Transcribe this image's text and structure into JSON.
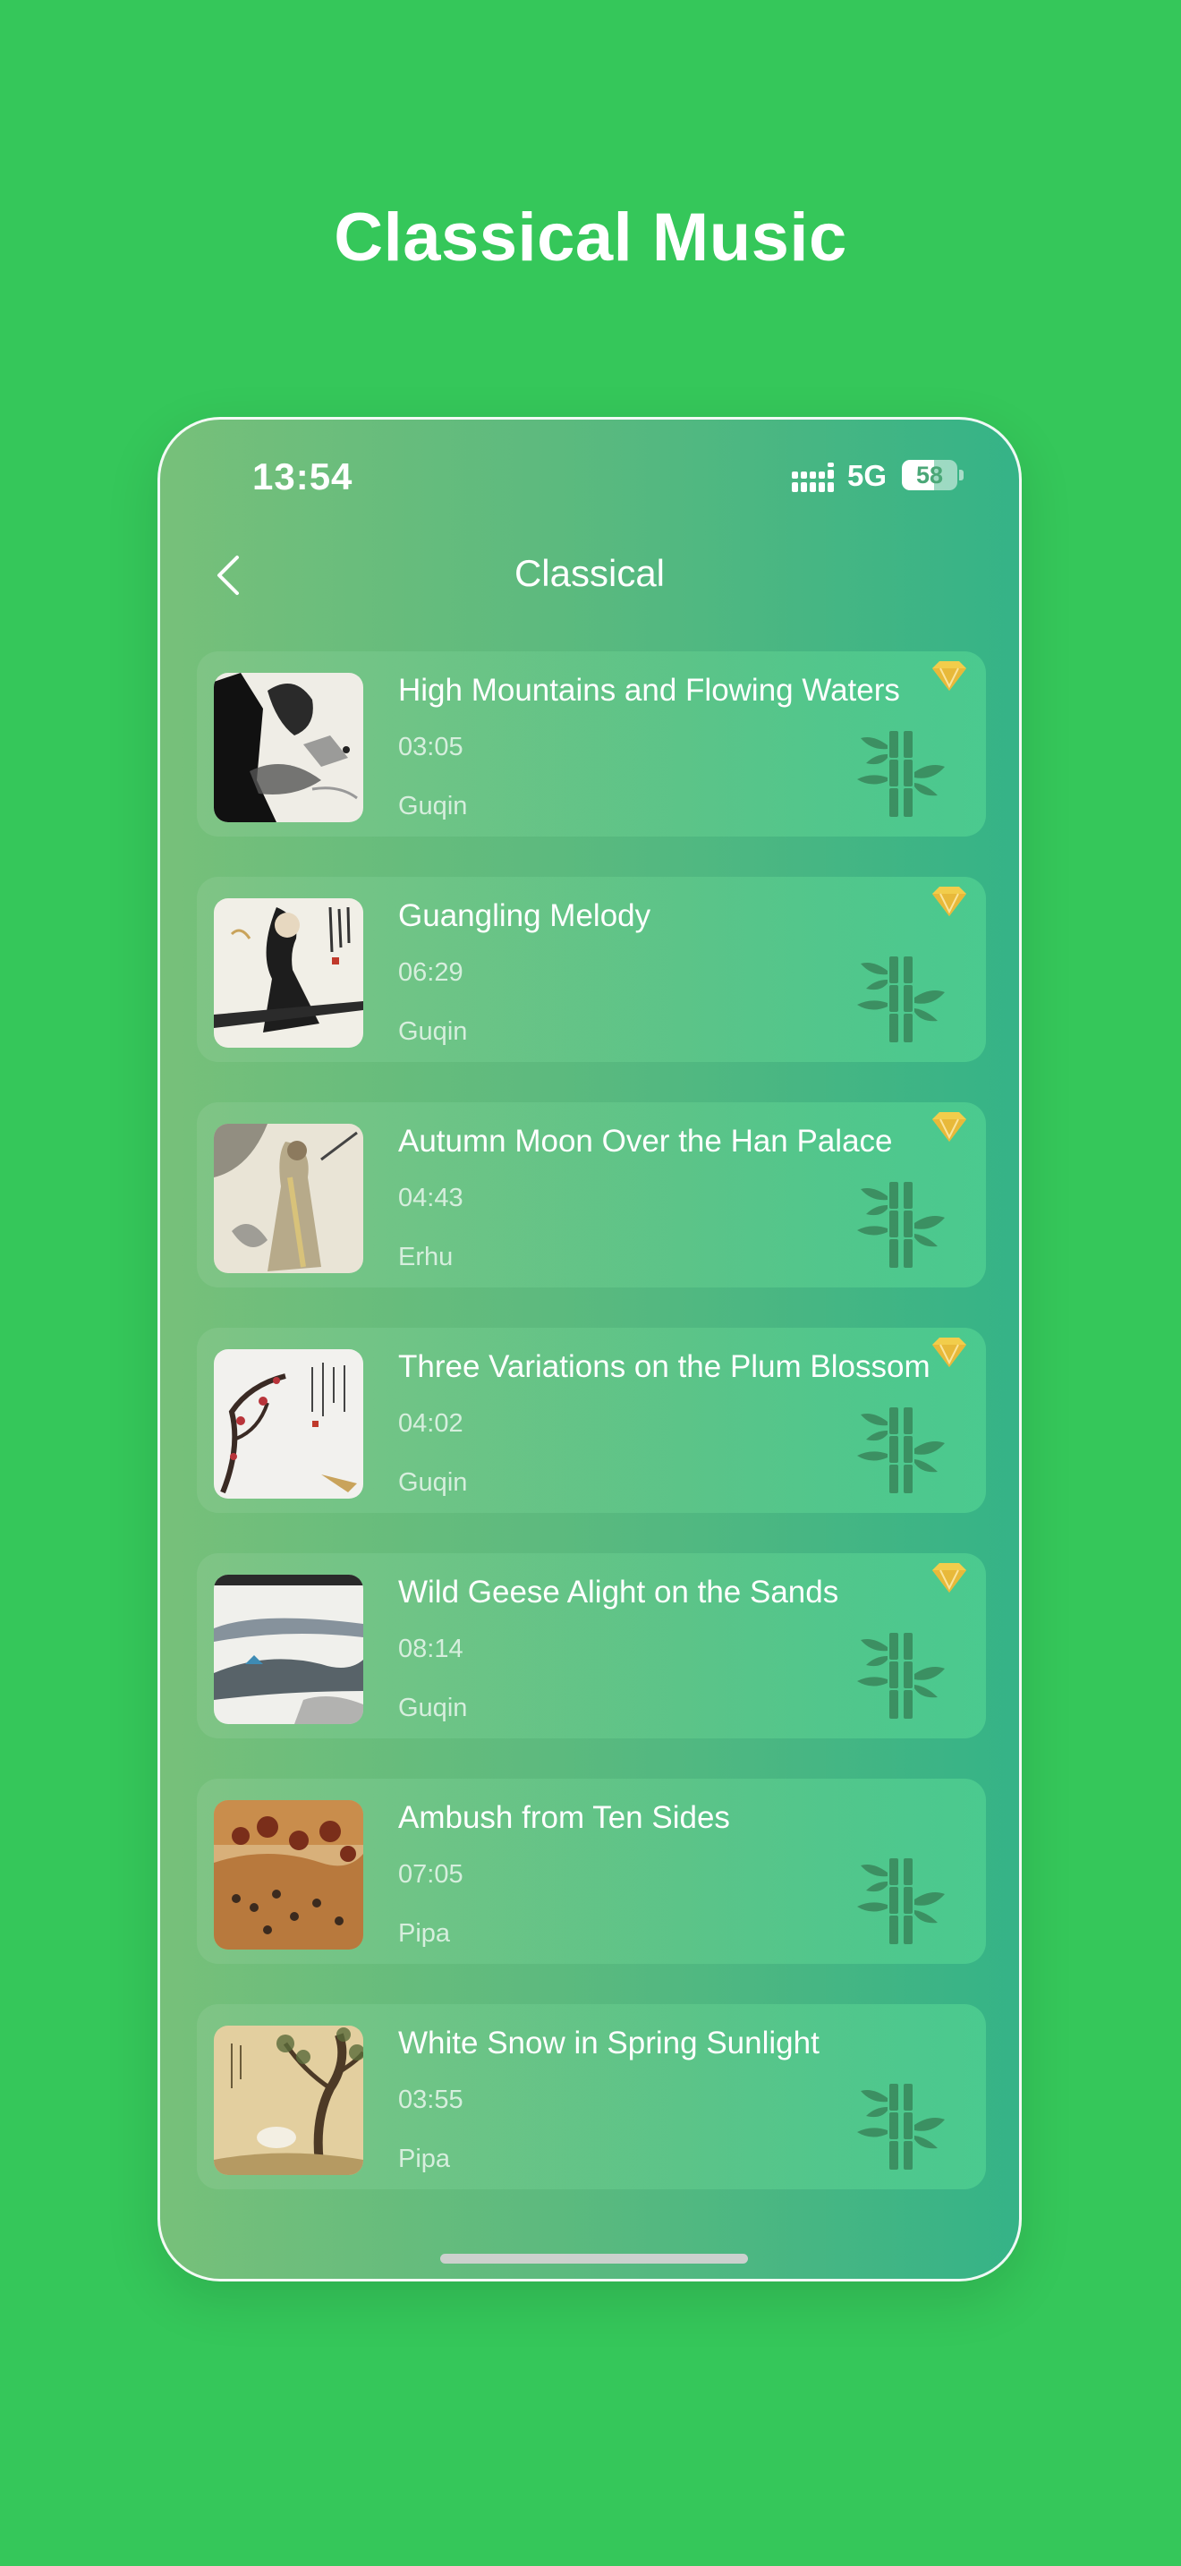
{
  "promo_title": "Classical Music",
  "status_bar": {
    "time": "13:54",
    "network": "5G",
    "battery": "58",
    "battery_fraction": 0.58
  },
  "nav": {
    "title": "Classical"
  },
  "tracks": [
    {
      "title": "High Mountains and Flowing Waters",
      "duration": "03:05",
      "instrument": "Guqin",
      "vip": true
    },
    {
      "title": "Guangling Melody",
      "duration": "06:29",
      "instrument": "Guqin",
      "vip": true
    },
    {
      "title": "Autumn Moon Over the Han Palace",
      "duration": "04:43",
      "instrument": "Erhu",
      "vip": true
    },
    {
      "title": "Three Variations on the Plum Blossom",
      "duration": "04:02",
      "instrument": "Guqin",
      "vip": true
    },
    {
      "title": "Wild Geese Alight on the Sands",
      "duration": "08:14",
      "instrument": "Guqin",
      "vip": true
    },
    {
      "title": "Ambush from Ten Sides",
      "duration": "07:05",
      "instrument": "Pipa",
      "vip": false
    },
    {
      "title": "White Snow in Spring Sunlight",
      "duration": "03:55",
      "instrument": "Pipa",
      "vip": false
    }
  ],
  "colors": {
    "page_background": "#35c75a",
    "vip_gold": "#f2cd4b",
    "bamboo": "#3a8a5e"
  },
  "icons": {
    "back": "chevron-left-icon",
    "signal": "signal-bars-icon",
    "vip": "diamond-icon",
    "bamboo": "bamboo-icon"
  }
}
